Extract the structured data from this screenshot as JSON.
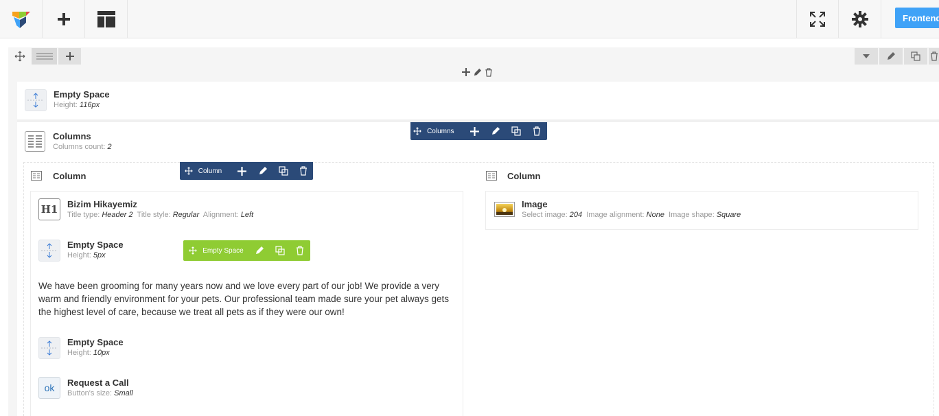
{
  "navbar": {
    "frontend_label": "Frontend"
  },
  "row": {
    "icons": [
      "move-icon",
      "layout-icon",
      "add-icon",
      "toggle-icon",
      "edit-icon",
      "clone-icon",
      "delete-icon"
    ]
  },
  "elements": {
    "empty_space_top": {
      "title": "Empty Space",
      "param_label": "Height",
      "param_value": "116px"
    },
    "columns": {
      "title": "Columns",
      "param_label": "Columns count",
      "param_value": "2",
      "toolbar_label": "Columns"
    },
    "column_left": {
      "title": "Column",
      "toolbar_label": "Column"
    },
    "column_right": {
      "title": "Column"
    },
    "heading": {
      "title": "Bizim Hikayemiz",
      "icon_text": "H1",
      "p1_label": "Title type",
      "p1_value": "Header 2",
      "p2_label": "Title style",
      "p2_value": "Regular",
      "p3_label": "Alignment",
      "p3_value": "Left"
    },
    "empty_space_a": {
      "title": "Empty Space",
      "param_label": "Height",
      "param_value": "5px",
      "toolbar_label": "Empty Space"
    },
    "text_block": {
      "text": "We have been grooming for many years now and we love every part of our job! We provide a very warm and friendly environment for your pets. Our professional team made sure your pet always gets the highest level of care, because we treat all pets as if they were our own!"
    },
    "empty_space_b": {
      "title": "Empty Space",
      "param_label": "Height",
      "param_value": "10px"
    },
    "button": {
      "title": "Request a Call",
      "icon_text": "ok",
      "param_label": "Button's size",
      "param_value": "Small"
    },
    "image": {
      "title": "Image",
      "p1_label": "Select image",
      "p1_value": "204",
      "p2_label": "Image alignment",
      "p2_value": "None",
      "p3_label": "Image shape",
      "p3_value": "Square"
    }
  },
  "colors": {
    "toolbar_dark": "#2b4a78",
    "toolbar_green": "#8fcc33",
    "frontend_button": "#3fa2f7"
  }
}
